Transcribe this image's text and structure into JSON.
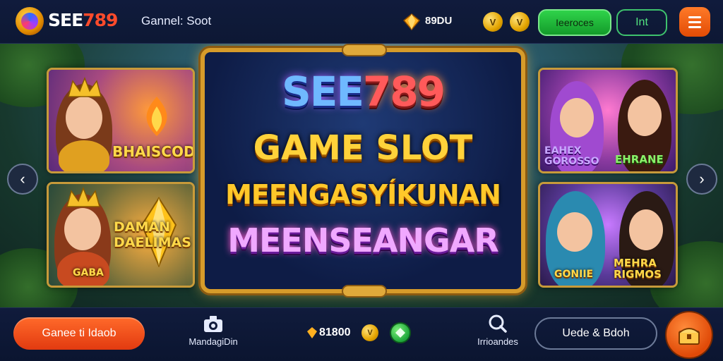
{
  "header": {
    "brand_prefix": "SEE",
    "brand_suffix": "789",
    "nav_title": "Gannel: Soot",
    "balance": "89DU",
    "coin1_symbol": "V",
    "coin2_symbol": "V",
    "green_button": "Ieeroces",
    "outline_button": "Int"
  },
  "hero": {
    "brand_prefix": "SEE",
    "brand_suffix": "789",
    "line1": "GAME SLOT",
    "line2": "MEENGASYÍKUNAN",
    "line3": "MEENSEANGAR",
    "cards_left": [
      {
        "label": "BHAISCOD"
      },
      {
        "label": "DAMAN DAELIMAS",
        "sub": "GABA"
      }
    ],
    "cards_right": [
      {
        "label": "EAHEX GOROSSO",
        "label2": "EHRANE"
      },
      {
        "label": "GONIIE",
        "label2": "MEHRA RIGMOS"
      }
    ]
  },
  "footer": {
    "primary_button": "Ganee ti Idaob",
    "nav_left_label": "MandagiDin",
    "amount": "81800",
    "coin_symbol": "V",
    "nav_right_label": "Irrioandes",
    "pill_button": "Uede & Bdoh"
  },
  "colors": {
    "accent_orange": "#ff5a1f",
    "accent_green": "#1fbf3a",
    "gold": "#ffd23a",
    "bg_dark": "#0c1633"
  },
  "icons": [
    "logo-icon",
    "diamond-balance-icon",
    "coin-icon",
    "menu-icon",
    "chevron-left-icon",
    "chevron-right-icon",
    "camera-icon",
    "gem-icon",
    "search-icon",
    "treasure-icon"
  ]
}
